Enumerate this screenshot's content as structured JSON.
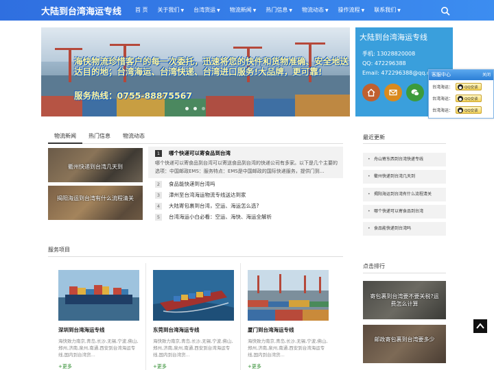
{
  "brand": "大陆到台湾海运专线",
  "nav": {
    "items": [
      {
        "label": "首 页",
        "caret": ""
      },
      {
        "label": "关于我们",
        "caret": "▼"
      },
      {
        "label": "台湾货运",
        "caret": "▼"
      },
      {
        "label": "物流新闻",
        "caret": "▼"
      },
      {
        "label": "热门信息",
        "caret": "▼"
      },
      {
        "label": "物流动态",
        "caret": "▼"
      },
      {
        "label": "操作流程",
        "caret": "▼"
      },
      {
        "label": "联系我们",
        "caret": "▼"
      }
    ]
  },
  "banner": {
    "text": "海快物流珍惜客户的每一次委托，迅速将您的快件和货物准确、安全地送达目的地；台湾海运、台湾快递、台湾进口服务!大品牌，更可靠!",
    "hotline": "服务热线：0755-88875567"
  },
  "contact": {
    "title": "大陆到台湾海运专线",
    "phone": "手机:  13028820008",
    "qq": "QQ:   472296388",
    "email": "Email:  472296388@qq.com"
  },
  "float_service": {
    "title": "客服中心",
    "close": "关闭",
    "rows": [
      {
        "label": "台湾海运：",
        "btn": "QQ交谈"
      },
      {
        "label": "台湾海运：",
        "btn": "QQ交谈"
      },
      {
        "label": "台湾海运：",
        "btn": "QQ交谈"
      }
    ]
  },
  "news": {
    "tabs": [
      "物流新闻",
      "热门信息",
      "物流动态"
    ],
    "thumbs": [
      {
        "caption": "衢州快递到台湾几天到"
      },
      {
        "caption": "揭阳海运到台湾有什么流程清关"
      }
    ],
    "top": {
      "num": "1",
      "title": "哪个快递可以寄食品到台湾",
      "desc": "哪个快递可以寄食品到台湾可以寄送食品到台湾的快递公司有多家。以下是几个主要的选项：中国邮政EMS：服务特点：EMS是中国邮政的国际快递服务，提供门到..."
    },
    "list": [
      {
        "num": "2",
        "title": "食品能快递到台湾吗"
      },
      {
        "num": "3",
        "title": "漳州至台湾海运物流专线送达到家"
      },
      {
        "num": "4",
        "title": "大陆寄包裹到台湾，空运、海运怎么选?"
      },
      {
        "num": "5",
        "title": "台湾海运小白必看：空运、海快、海运全解析"
      }
    ]
  },
  "sidebar": {
    "recent_title": "最近更新",
    "recent": [
      "舟山寄东西到台湾快递专线",
      "衢州快递到台湾几天到",
      "揭阳海运到台湾有什么流程清关",
      "哪个快递可以寄食品到台湾",
      "食品能快递到台湾吗"
    ],
    "rank_title": "点击排行",
    "rank": [
      {
        "caption": "寄包裹到台湾要不要关税?运费怎么计算"
      },
      {
        "caption": "邮政寄包裹到台湾要多少"
      }
    ]
  },
  "services": {
    "title": "服务项目",
    "cards": [
      {
        "title": "深圳到台湾海运专线",
        "desc": "海快致力南京,青岛,长沙,无锡,宁波,佛山,郑州,济南,泉州,南通,西安到台湾海运专线,国内到台湾货...",
        "more": "+更多"
      },
      {
        "title": "东莞到台湾海运专线",
        "desc": "海快致力南京,青岛,长沙,无锡,宁波,佛山,郑州,济南,泉州,南通,西安到台湾海运专线,国内到台湾货...",
        "more": "+更多"
      },
      {
        "title": "厦门到台湾海运专线",
        "desc": "海快致力南京,青岛,长沙,无锡,宁波,佛山,郑州,济南,泉州,南通,西安到台湾海运专线,国内到台湾货...",
        "more": "+更多"
      }
    ]
  },
  "colors": {
    "nav": "#3c8df0",
    "contact_bg": "#3a9fdc",
    "accent_green": "#2a8a2a"
  },
  "icons": [
    "search-icon",
    "home-icon",
    "mail-icon",
    "wechat-icon",
    "qq-icon",
    "back-to-top-icon"
  ]
}
